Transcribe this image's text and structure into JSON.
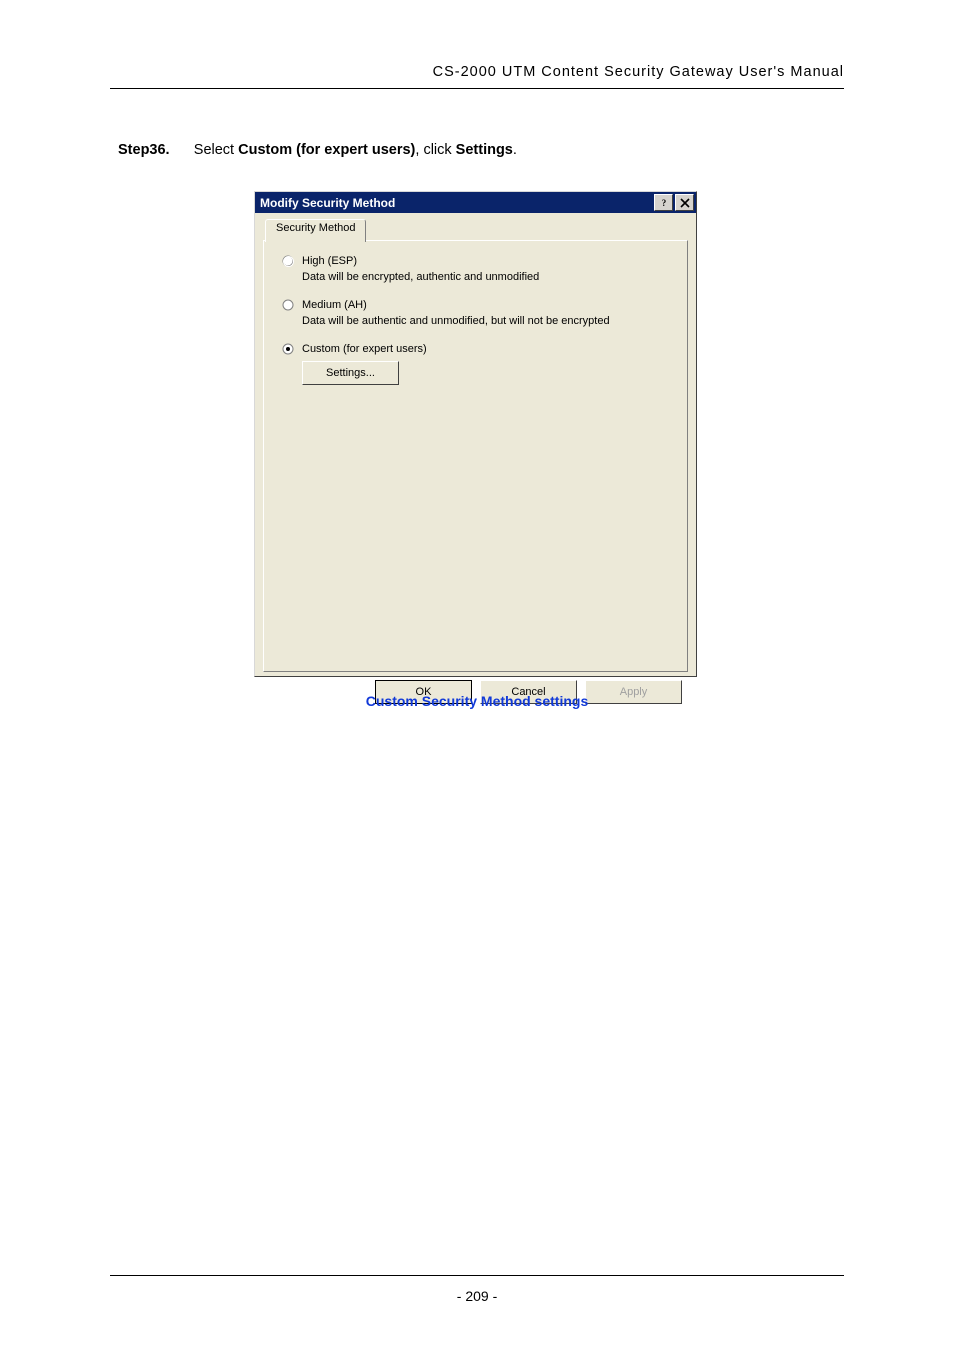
{
  "header": "CS-2000 UTM Content Security Gateway User's Manual",
  "step": {
    "id": "Step36.",
    "prefix": "Select ",
    "bold1": "Custom (for expert users)",
    "mid": ", click ",
    "bold2": "Settings",
    "suffix": "."
  },
  "dialog": {
    "title": "Modify Security Method",
    "tab_label": "Security Method",
    "radio_high": {
      "label": "High (ESP)",
      "desc": "Data will be encrypted, authentic and unmodified"
    },
    "radio_medium": {
      "label": "Medium (AH)",
      "desc": "Data will be authentic and unmodified, but will not be encrypted"
    },
    "radio_custom": {
      "label": "Custom (for expert users)"
    },
    "settings_btn": "Settings...",
    "ok": "OK",
    "cancel": "Cancel",
    "apply": "Apply"
  },
  "caption": "Custom Security Method settings",
  "footer": "- 209 -"
}
